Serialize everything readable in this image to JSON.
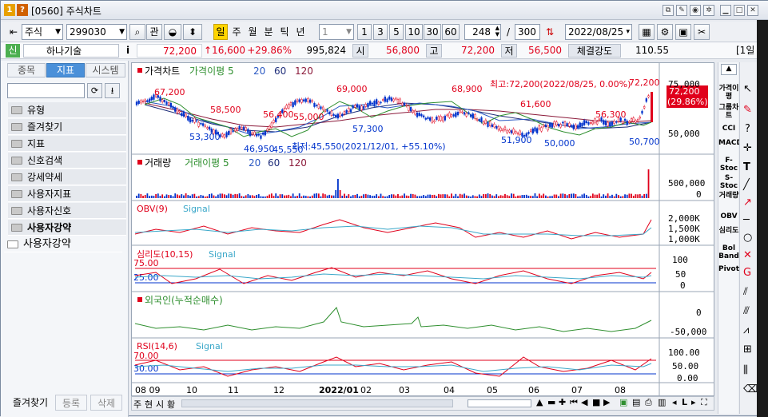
{
  "window": {
    "number_badge": "1",
    "help_badge": "?",
    "title": "[0560] 주식차트"
  },
  "toolbar": {
    "market": "주식",
    "code": "299030",
    "btn_watch": "관",
    "periods": [
      "일",
      "주",
      "월",
      "분",
      "틱",
      "년"
    ],
    "period_unit": "1",
    "quick_counts": [
      "1",
      "3",
      "5",
      "10",
      "30",
      "60"
    ],
    "display_count": "248",
    "total_count": "300",
    "date": "2022/08/25"
  },
  "quote": {
    "badge": "신",
    "name": "하나기술",
    "info_icon": "i",
    "price": "72,200",
    "change": "↑16,600",
    "change_pct": "+29.86%",
    "volume": "995,824",
    "open_label": "시",
    "open": "56,800",
    "high_label": "고",
    "high": "72,200",
    "low_label": "저",
    "low": "56,500",
    "strength_label": "체결강도",
    "strength": "110.55",
    "right_tag": "[1일"
  },
  "left_panel": {
    "tabs": [
      "종목",
      "지표",
      "시스템"
    ],
    "folders": [
      "유형",
      "즐겨찾기",
      "지표",
      "신호검색",
      "강세약세",
      "사용자지표",
      "사용자신호",
      "사용자강약",
      "사용자강약"
    ],
    "bottom": [
      "즐겨찾기",
      "등록",
      "삭제"
    ]
  },
  "panes": {
    "price": {
      "title": "가격차트",
      "legend": [
        "가격이평 5",
        "20",
        "60",
        "120"
      ],
      "max_note": "최고:72,200(2022/08/25, 0.00%)",
      "min_note": "최저:45,550(2021/12/01, +55.10%)",
      "last_price": "72,200",
      "last_pct": "(29.86%)",
      "axis": [
        "75,000",
        "50,000"
      ],
      "peaks": [
        "67,200",
        "58,500",
        "56,400",
        "55,000",
        "69,000",
        "57,300",
        "68,900",
        "61,600",
        "56,300",
        "72,200"
      ],
      "troughs": [
        "53,300",
        "46,950",
        "45,550",
        "51,900",
        "50,000",
        "50,700"
      ]
    },
    "volume": {
      "title": "거래량",
      "legend": [
        "거래이평 5",
        "20",
        "60",
        "120"
      ],
      "axis": [
        "500,000",
        "0"
      ]
    },
    "obv": {
      "title": "OBV(9)",
      "signal": "Signal",
      "axis": [
        "2,000K",
        "1,500K",
        "1,000K"
      ]
    },
    "psych": {
      "title": "심리도(10,15)",
      "signal": "Signal",
      "levels": [
        "75.00",
        "25.00"
      ],
      "axis": [
        "100",
        "50",
        "0"
      ]
    },
    "foreign": {
      "title": "외국인(누적순매수)",
      "axis": [
        "0",
        "-50,000"
      ]
    },
    "rsi": {
      "title": "RSI(14,6)",
      "signal": "Signal",
      "levels": [
        "70.00",
        "30.00"
      ],
      "axis": [
        "100.00",
        "50.00",
        "0.00"
      ]
    }
  },
  "x_axis": [
    "08 09",
    "10",
    "11",
    "12",
    "2022/01",
    "02",
    "03",
    "04",
    "05",
    "06",
    "07",
    "08"
  ],
  "bottom_bar": [
    "주",
    "현",
    "시",
    "황"
  ],
  "right_indicators": [
    "가격이평",
    "그룹차트",
    "CCI",
    "MACD",
    "F-Stoc",
    "S-Stoc",
    "거래량",
    "OBV",
    "심리도",
    "Bol Band",
    "Pivot"
  ],
  "colors": {
    "up": "#e0001b",
    "down": "#0033cc",
    "ma5": "#2f8f2f",
    "ma20": "#2b59c3",
    "ma60": "#1f2e7a",
    "ma120": "#8b1a3a",
    "signal": "#3aa7c9",
    "accent": "#ffd400"
  }
}
